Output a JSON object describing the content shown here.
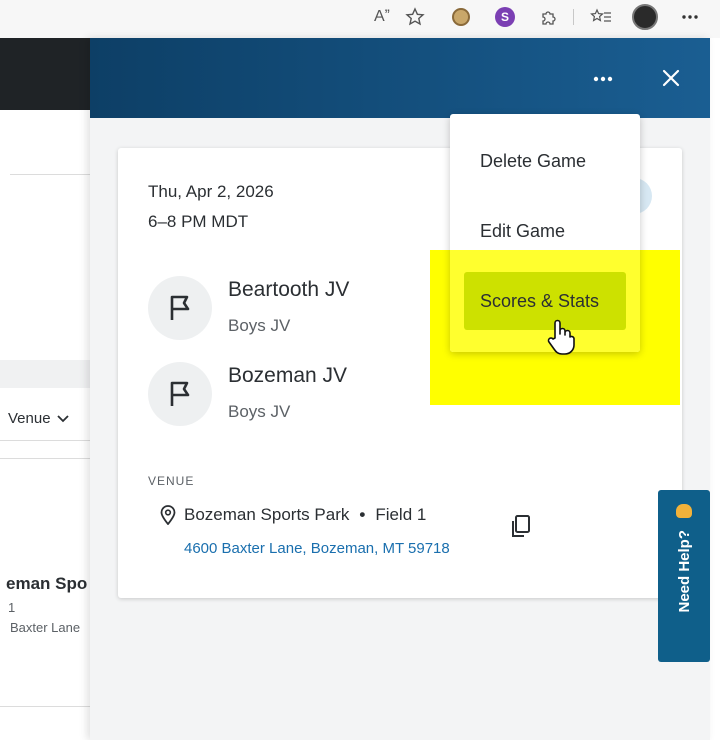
{
  "browser": {
    "read_aloud_label": "Aˮ",
    "ext2_letter": "S"
  },
  "background": {
    "venue_filter": "Venue",
    "row_name": "eman Spo",
    "row_num": "1",
    "row_addr": "Baxter Lane"
  },
  "drawer": {
    "more_label": "•••",
    "close_label": "✕"
  },
  "game": {
    "date": "Thu, Apr 2, 2026",
    "time": "6–8 PM MDT",
    "teams": [
      {
        "name": "Beartooth JV",
        "level": "Boys JV"
      },
      {
        "name": "Bozeman JV",
        "level": "Boys JV"
      }
    ],
    "venue_label": "VENUE",
    "venue_name": "Bozeman Sports Park",
    "venue_separator": "•",
    "venue_field": "Field 1",
    "venue_address": "4600 Baxter Lane, Bozeman, MT 59718"
  },
  "menu": {
    "items": [
      {
        "label": "Delete Game"
      },
      {
        "label": "Edit Game"
      },
      {
        "label": "Scores & Stats"
      }
    ]
  },
  "help": {
    "label": "Need Help?"
  },
  "colors": {
    "header_start": "#0d3f66",
    "header_end": "#1a5e92",
    "link": "#1a6fae",
    "highlight": "#ffff00",
    "help_bg": "#0f5f8a"
  }
}
